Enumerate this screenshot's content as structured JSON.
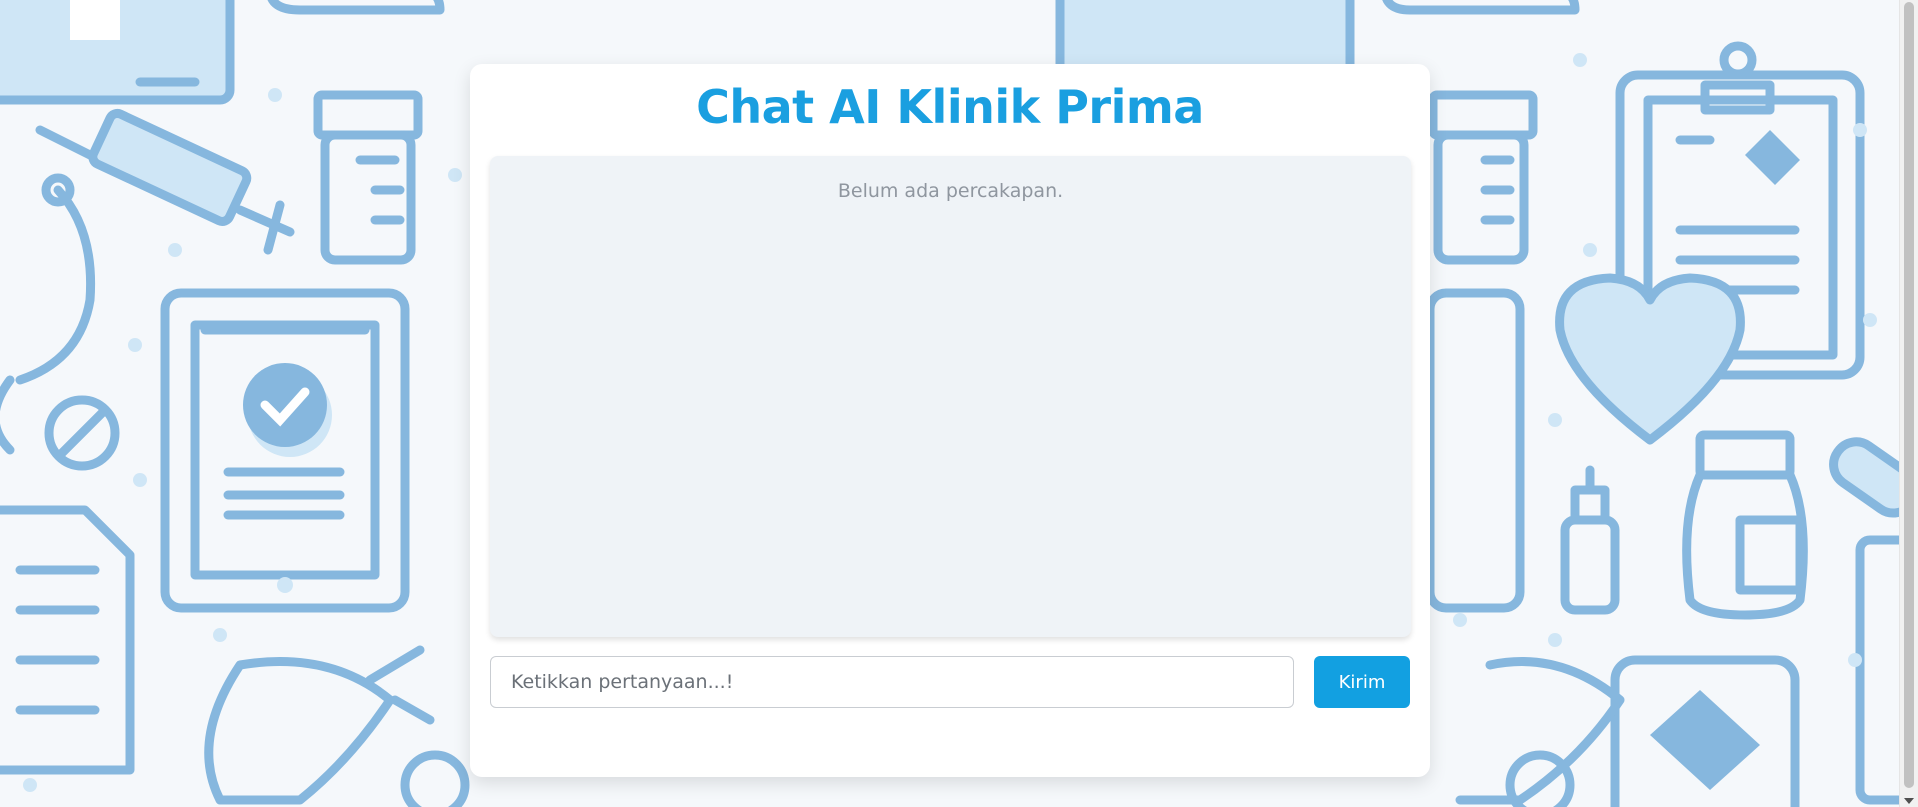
{
  "app": {
    "title": "Chat AI Klinik Prima"
  },
  "chat": {
    "empty_message": "Belum ada percakapan."
  },
  "composer": {
    "placeholder": "Ketikkan pertanyaan...!",
    "value": "",
    "send_label": "Kirim"
  },
  "theme": {
    "accent": "#1a9fe0",
    "button": "#12a0e1",
    "background_icon_color": "#86b7de"
  },
  "background": {
    "icons": [
      "medical-kit-icon",
      "syringe-icon",
      "stethoscope-icon",
      "pill-bottle-icon",
      "clipboard-icon",
      "tablet-check-icon",
      "heart-icon",
      "document-icon",
      "prohibited-icon",
      "bandage-icon",
      "capsule-icon",
      "dropper-bottle-icon"
    ]
  }
}
